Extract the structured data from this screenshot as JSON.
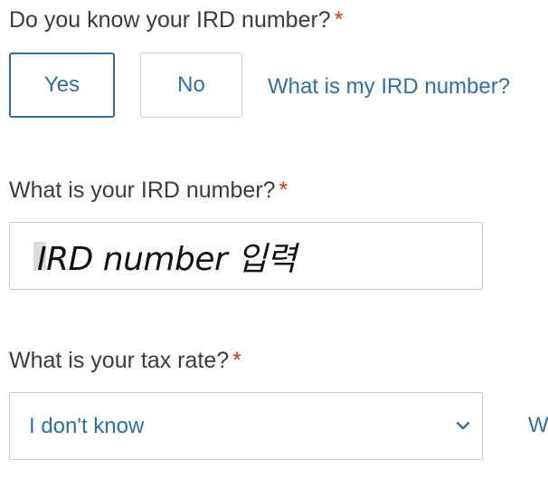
{
  "ird_known": {
    "question": "Do you know your IRD number?",
    "required_mark": "*",
    "yes_label": "Yes",
    "no_label": "No",
    "selected": "Yes",
    "help_link": "What is my IRD number?"
  },
  "ird_number": {
    "question": "What is your IRD number?",
    "required_mark": "*",
    "value": "IRD number 입력"
  },
  "tax_rate": {
    "question": "What is your tax rate?",
    "required_mark": "*",
    "selected_option": "I don't know",
    "help_link": "W"
  },
  "colors": {
    "accent": "#2f6fa8",
    "required": "#d4351c",
    "border": "#c9c9c9",
    "label": "#3b3b3b"
  },
  "icons": {
    "select_arrow": "chevron-down-icon"
  }
}
